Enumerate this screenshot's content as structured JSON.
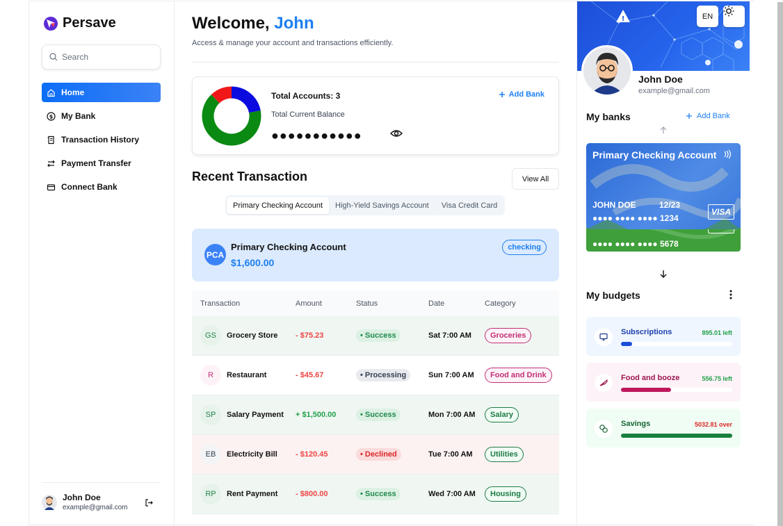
{
  "app": {
    "name": "Persave"
  },
  "search": {
    "placeholder": "Search"
  },
  "nav": [
    {
      "label": "Home",
      "icon": "home-icon",
      "active": true
    },
    {
      "label": "My Bank",
      "icon": "dollar-circle-icon"
    },
    {
      "label": "Transaction History",
      "icon": "receipt-icon"
    },
    {
      "label": "Payment Transfer",
      "icon": "transfer-icon"
    },
    {
      "label": "Connect Bank",
      "icon": "card-icon"
    }
  ],
  "user": {
    "name": "John Doe",
    "email": "example@gmail.com"
  },
  "header": {
    "greeting": "Welcome,",
    "first_name": "John",
    "subtitle": "Access & manage your account and transactions efficiently."
  },
  "summary": {
    "total_accounts": "Total Accounts: 3",
    "balance_label": "Total Current Balance",
    "balance_masked": "●●●●●●●●●●●",
    "add_bank": "Add Bank",
    "donut": [
      {
        "label": "blue",
        "value": 0.22,
        "color": "#0b0be0"
      },
      {
        "label": "green",
        "value": 0.66,
        "color": "#0a8a12"
      },
      {
        "label": "red",
        "value": 0.12,
        "color": "#f01818"
      }
    ]
  },
  "recent": {
    "title": "Recent Transaction",
    "view_all": "View All",
    "tabs": [
      "Primary Checking Account",
      "High-Yield Savings Account",
      "Visa Credit Card"
    ],
    "active_tab": 0
  },
  "account": {
    "initials": "PCA",
    "name": "Primary Checking Account",
    "balance": "$1,600.00",
    "type": "checking"
  },
  "table": {
    "columns": [
      "Transaction",
      "Amount",
      "Status",
      "Date",
      "Category"
    ],
    "rows": [
      {
        "initials": "GS",
        "name": "Grocery Store",
        "amount": "- $75.23",
        "status": "Success",
        "date": "Sat 7:00 AM",
        "category": "Groceries",
        "kind": "success",
        "cat_color": "pink"
      },
      {
        "initials": "R",
        "name": "Restaurant",
        "amount": "- $45.67",
        "status": "Processing",
        "date": "Sun 7:00 AM",
        "category": "Food and Drink",
        "kind": "processing",
        "cat_color": "pink"
      },
      {
        "initials": "SP",
        "name": "Salary Payment",
        "amount": "+ $1,500.00",
        "status": "Success",
        "date": "Mon 7:00 AM",
        "category": "Salary",
        "kind": "success",
        "cat_color": "green",
        "positive": true
      },
      {
        "initials": "EB",
        "name": "Electricity Bill",
        "amount": "- $120.45",
        "status": "Declined",
        "date": "Tue 7:00 AM",
        "category": "Utilities",
        "kind": "declined",
        "cat_color": "green"
      },
      {
        "initials": "RP",
        "name": "Rent Payment",
        "amount": "- $800.00",
        "status": "Success",
        "date": "Wed 7:00 AM",
        "category": "Housing",
        "kind": "success",
        "cat_color": "green"
      }
    ]
  },
  "right": {
    "lang": "EN",
    "my_banks": "My banks",
    "add_bank": "Add Bank",
    "card_front": {
      "title": "Primary Checking Account",
      "holder": "JOHN DOE",
      "expiry": "12/23",
      "number": "●●●● ●●●● ●●●● 1234",
      "brand": "VISA"
    },
    "card_back": {
      "number": "●●●● ●●●● ●●●● 5678",
      "brand": "VISA"
    },
    "my_budgets": "My budgets",
    "budgets": [
      {
        "name": "Subscriptions",
        "left": "895.01 left",
        "progress": 0.1,
        "bg": "#eff6ff",
        "name_color": "#1e40af",
        "left_color": "#22a14a",
        "fill": "#1d4ed8",
        "icon": "monitor-icon"
      },
      {
        "name": "Food and booze",
        "left": "556.75 left",
        "progress": 0.45,
        "bg": "#fdf2f8",
        "name_color": "#9d174d",
        "left_color": "#22a14a",
        "fill": "#be185d",
        "icon": "pizza-icon"
      },
      {
        "name": "Savings",
        "left": "5032.81 over",
        "progress": 1.0,
        "bg": "#f0fdf4",
        "name_color": "#166534",
        "left_color": "#dc2626",
        "fill": "#15803d",
        "icon": "coins-icon"
      }
    ]
  }
}
